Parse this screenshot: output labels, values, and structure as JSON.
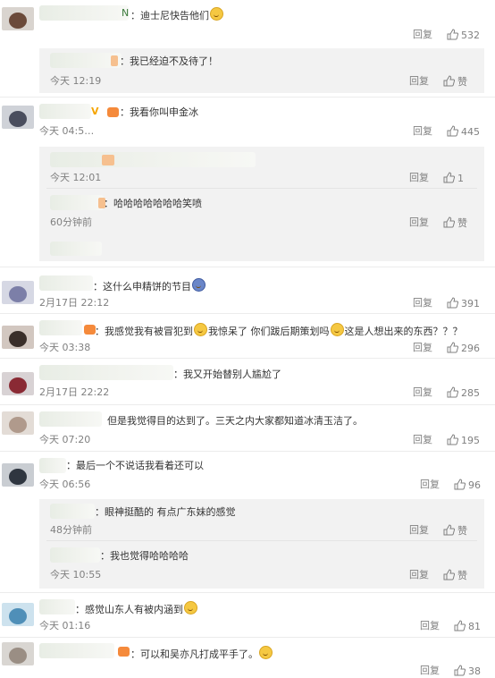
{
  "actions": {
    "reply": "回复",
    "like": "赞"
  },
  "c1": {
    "name_tail": "N",
    "text": "：迪士尼快告他们",
    "time": "",
    "likes": "532"
  },
  "c1r1": {
    "text": "：我已经迫不及待了！",
    "time": "今天 12:19"
  },
  "c2": {
    "name_tail": "V",
    "text": "：我看你叫申金冰",
    "time": "今天 04:5…",
    "likes": "445"
  },
  "c2r1": {
    "text": "",
    "time": "今天 12:01",
    "likes": "1"
  },
  "c2r2": {
    "text": "：哈哈哈哈哈哈哈笑喷",
    "time": "60分钟前"
  },
  "c3": {
    "text": "：这什么申精饼的节目",
    "time": "2月17日 22:12",
    "likes": "391"
  },
  "c4": {
    "text_a": "：我感觉我有被冒犯到",
    "text_b": "我惊呆了 你们跋后期策划吗",
    "text_c": "这是人想出来的东西？？？",
    "time": "今天 03:38",
    "likes": "296"
  },
  "c5": {
    "text": "：我又开始替别人尴尬了",
    "time": "2月17日 22:22",
    "likes": "285"
  },
  "c6": {
    "text": "但是我觉得目的达到了。三天之内大家都知道冰清玉洁了。",
    "time": "今天 07:20",
    "likes": "195"
  },
  "c7": {
    "text": "：最后一个不说话我看着还可以",
    "time": "今天 06:56",
    "likes": "96"
  },
  "c7r1": {
    "text": "：眼神挺酷的 有点广东妹的感觉",
    "time": "48分钟前"
  },
  "c7r2": {
    "text": "：我也觉得哈哈哈哈",
    "time": "今天 10:55"
  },
  "c8": {
    "text": "：感觉山东人有被内涵到",
    "time": "今天 01:16",
    "likes": "81"
  },
  "c9": {
    "text": "：可以和吴亦凡打成平手了。",
    "time": "",
    "likes": "38"
  }
}
